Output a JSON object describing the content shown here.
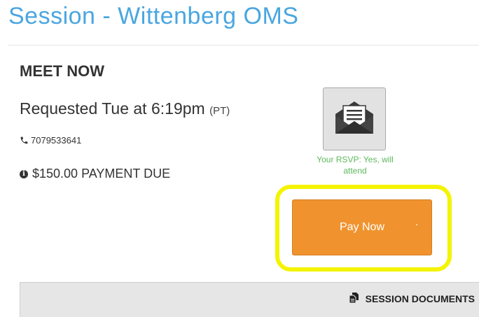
{
  "header": {
    "title": "Session - Wittenberg OMS"
  },
  "session": {
    "heading": "MEET NOW",
    "requested": "Requested Tue at 6:19pm",
    "timezone": "(PT)",
    "phone": "7079533641",
    "payment_due": "$150.00 PAYMENT DUE"
  },
  "rsvp": {
    "status": "Your RSVP: Yes, will attend"
  },
  "actions": {
    "pay_now_label": "Pay Now"
  },
  "documents": {
    "label": "SESSION DOCUMENTS"
  },
  "colors": {
    "title_blue": "#4aa6e0",
    "pay_orange": "#f0932f",
    "rsvp_green": "#5cb85c",
    "highlight_yellow": "#f4f400"
  },
  "icons": {
    "phone": "phone-icon",
    "info": "info-circle-icon",
    "rsvp": "envelope-letter-icon",
    "documents": "documents-icon"
  }
}
